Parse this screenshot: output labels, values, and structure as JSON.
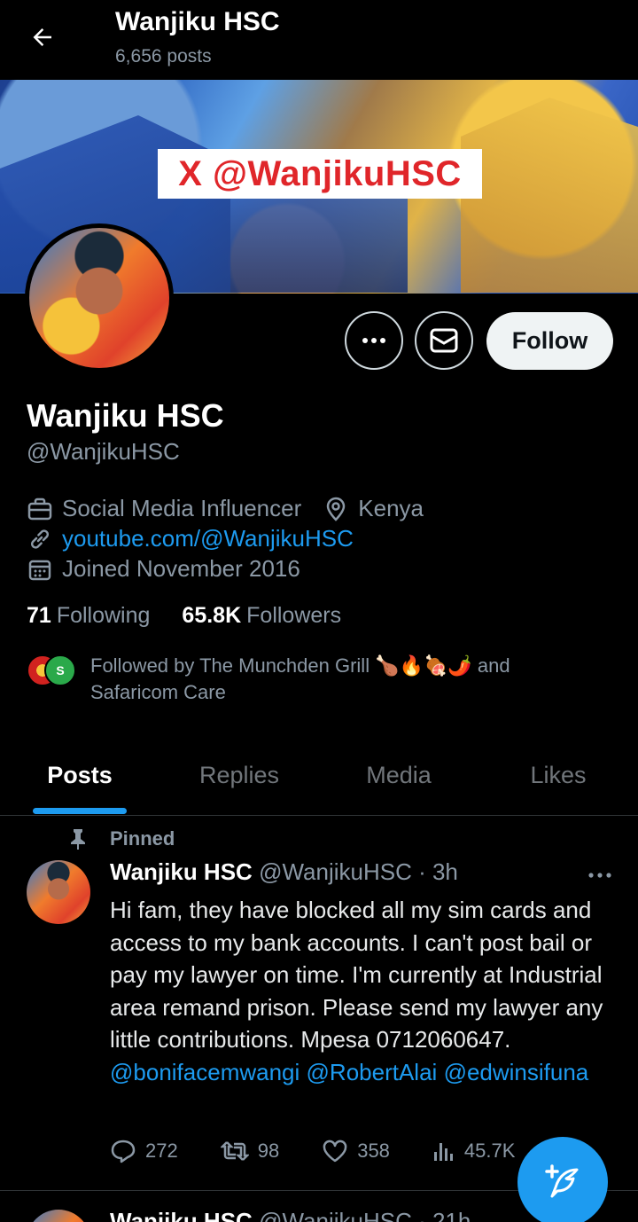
{
  "header": {
    "title": "Wanjiku HSC",
    "posts_count": "6,656 posts"
  },
  "banner": {
    "label": "X @WanjikuHSC"
  },
  "actions": {
    "follow_label": "Follow"
  },
  "profile": {
    "name": "Wanjiku HSC",
    "handle": "@WanjikuHSC",
    "category": "Social Media Influencer",
    "location": "Kenya",
    "website": "youtube.com/@WanjikuHSC",
    "joined": "Joined November 2016",
    "following_count": "71",
    "following_label": "Following",
    "followers_count": "65.8K",
    "followers_label": "Followers",
    "followed_by_line1": "Followed by The Munchden Grill 🍗🔥🍖🌶️ and",
    "followed_by_line2": "Safaricom Care",
    "followed_avatar_badge": "S"
  },
  "tabs": [
    {
      "label": "Posts",
      "active": true
    },
    {
      "label": "Replies",
      "active": false
    },
    {
      "label": "Media",
      "active": false
    },
    {
      "label": "Likes",
      "active": false
    }
  ],
  "pinned_tweet": {
    "pinned_label": "Pinned",
    "author_name": "Wanjiku HSC",
    "author_handle_time": "@WanjikuHSC · 3h",
    "body_text": "Hi fam, they have blocked all my sim cards and access to my bank accounts. I can't post bail or pay my lawyer on time. I'm currently at Industrial area remand prison. Please send my lawyer any little contributions. Mpesa 0712060647. ",
    "mentions": [
      "@bonifacemwangi",
      "@RobertAlai",
      "@edwinsifuna"
    ],
    "replies": "272",
    "reposts": "98",
    "likes": "358",
    "views": "45.7K"
  },
  "next_tweet": {
    "author_name": "Wanjiku HSC",
    "author_handle_time": "@WanjikuHSC · 21h"
  },
  "colors": {
    "accent": "#1d9bf0",
    "muted": "#8b98a5",
    "background": "#000000"
  }
}
